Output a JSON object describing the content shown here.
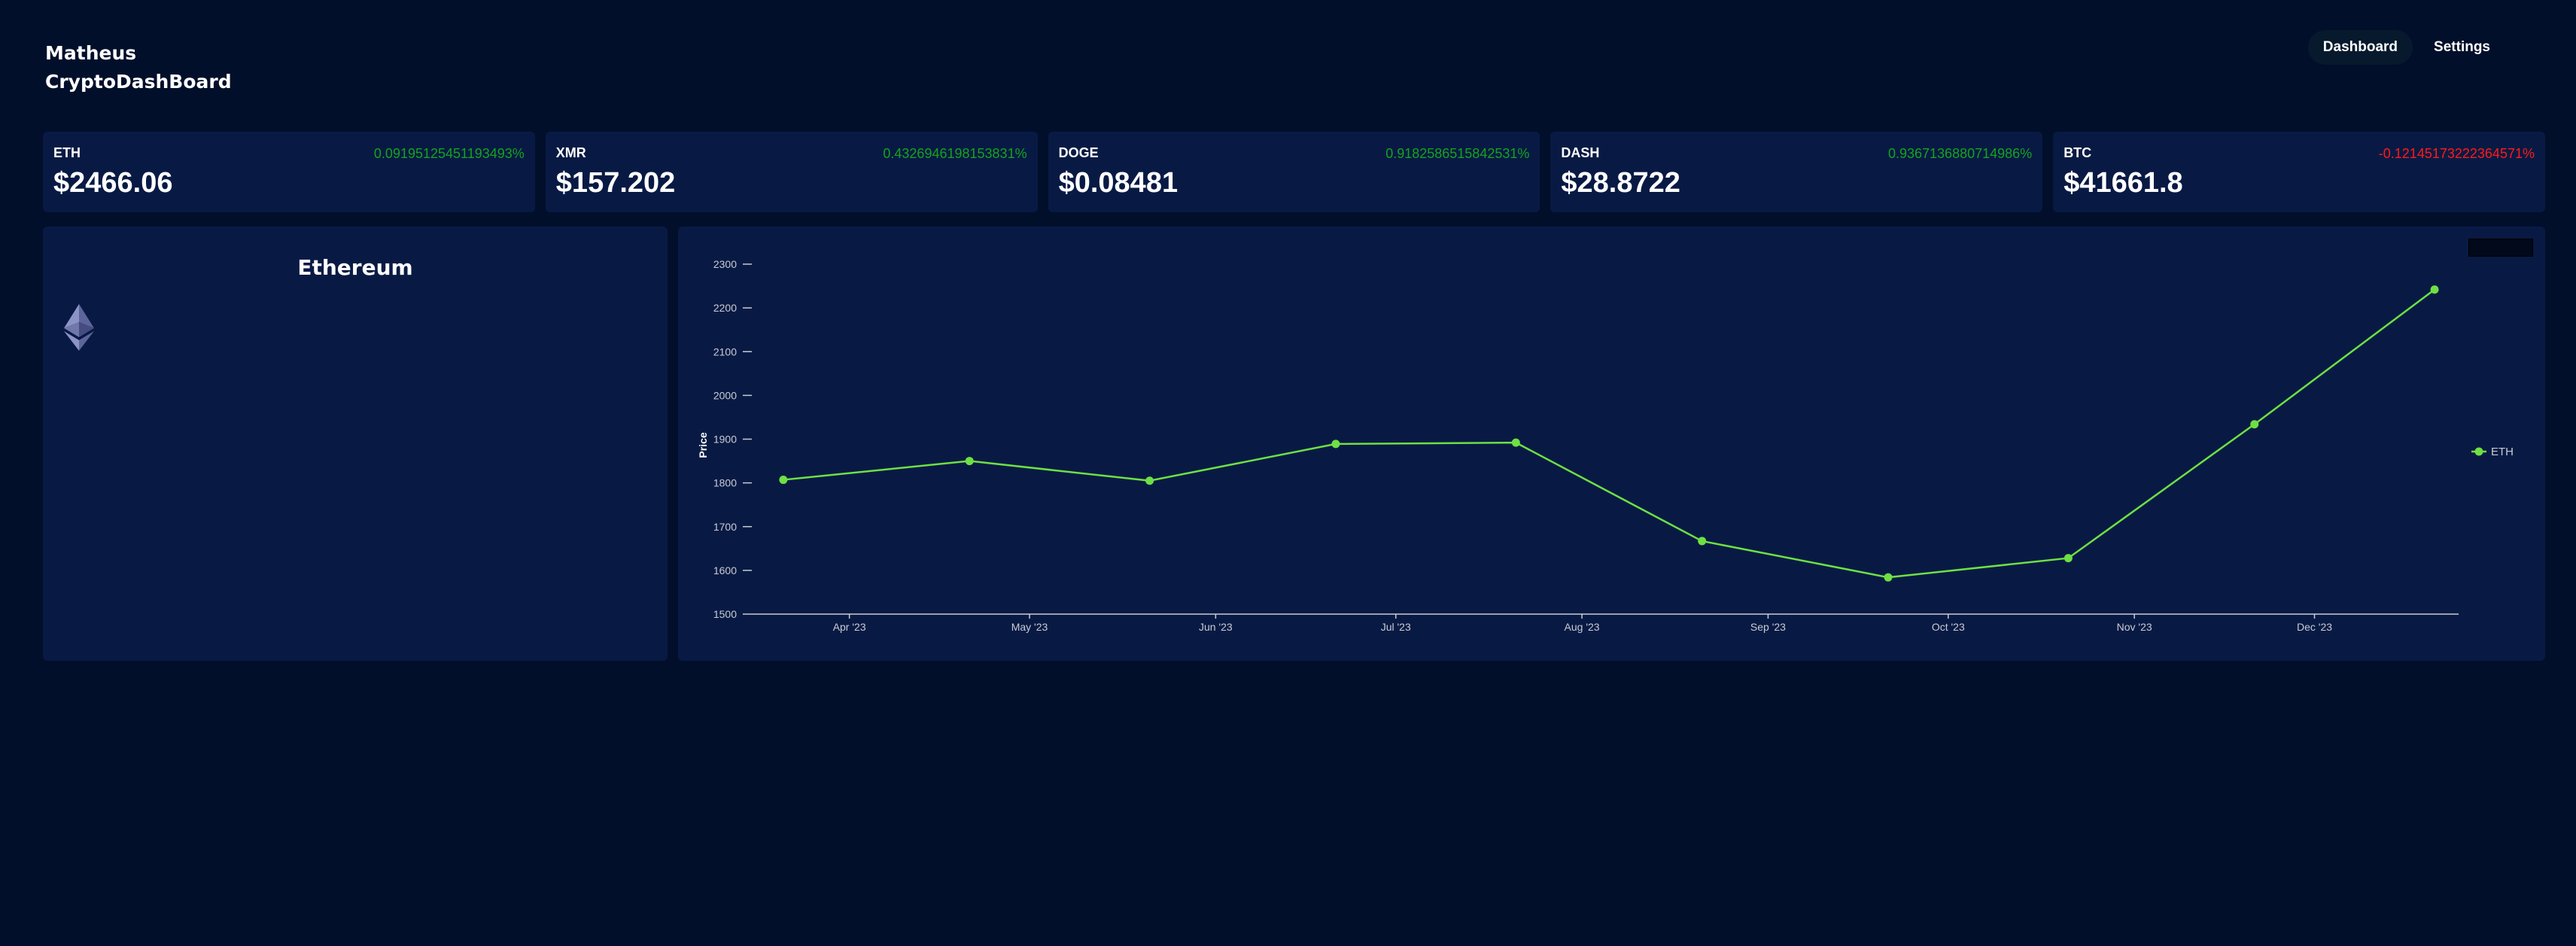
{
  "app": {
    "user": "Matheus",
    "name": "CryptoDashBoard"
  },
  "nav": {
    "dashboard": "Dashboard",
    "settings": "Settings"
  },
  "tickers": [
    {
      "symbol": "ETH",
      "price": "$2466.06",
      "change": "0.09195125451193493%",
      "trend": "up"
    },
    {
      "symbol": "XMR",
      "price": "$157.202",
      "change": "0.4326946198153831%",
      "trend": "up"
    },
    {
      "symbol": "DOGE",
      "price": "$0.08481",
      "change": "0.9182586515842531%",
      "trend": "up"
    },
    {
      "symbol": "DASH",
      "price": "$28.8722",
      "change": "0.9367136880714986%",
      "trend": "up"
    },
    {
      "symbol": "BTC",
      "price": "$41661.8",
      "change": "-0.12145173222364571%",
      "trend": "down"
    }
  ],
  "info": {
    "title": "Ethereum",
    "icon": "ethereum-icon"
  },
  "period_select": {
    "value": ""
  },
  "colors": {
    "positive": "#16a31c",
    "negative": "#ff1a1a",
    "line": "#6ee043",
    "background": "#010f2b",
    "panel": "#081a44"
  },
  "chart_data": {
    "type": "line",
    "x": [
      "2023-03-21",
      "2023-04-21",
      "2023-05-21",
      "2023-06-21",
      "2023-07-21",
      "2023-08-21",
      "2023-09-21",
      "2023-10-21",
      "2023-11-21",
      "2023-12-21"
    ],
    "series": [
      {
        "name": "ETH",
        "values": [
          1807,
          1850,
          1805,
          1889,
          1892,
          1667,
          1584,
          1628,
          1934,
          2242
        ]
      }
    ],
    "x_ticks": [
      "Apr '23",
      "May '23",
      "Jun '23",
      "Jul '23",
      "Aug '23",
      "Sep '23",
      "Oct '23",
      "Nov '23",
      "Dec '23"
    ],
    "y_ticks": [
      1500,
      1600,
      1700,
      1800,
      1900,
      2000,
      2100,
      2200,
      2300
    ],
    "ylim": [
      1500,
      2300
    ],
    "xlim": [
      "2023-03-16",
      "2023-12-25"
    ],
    "ylabel": "Price",
    "xlabel": "",
    "legend": "right"
  }
}
